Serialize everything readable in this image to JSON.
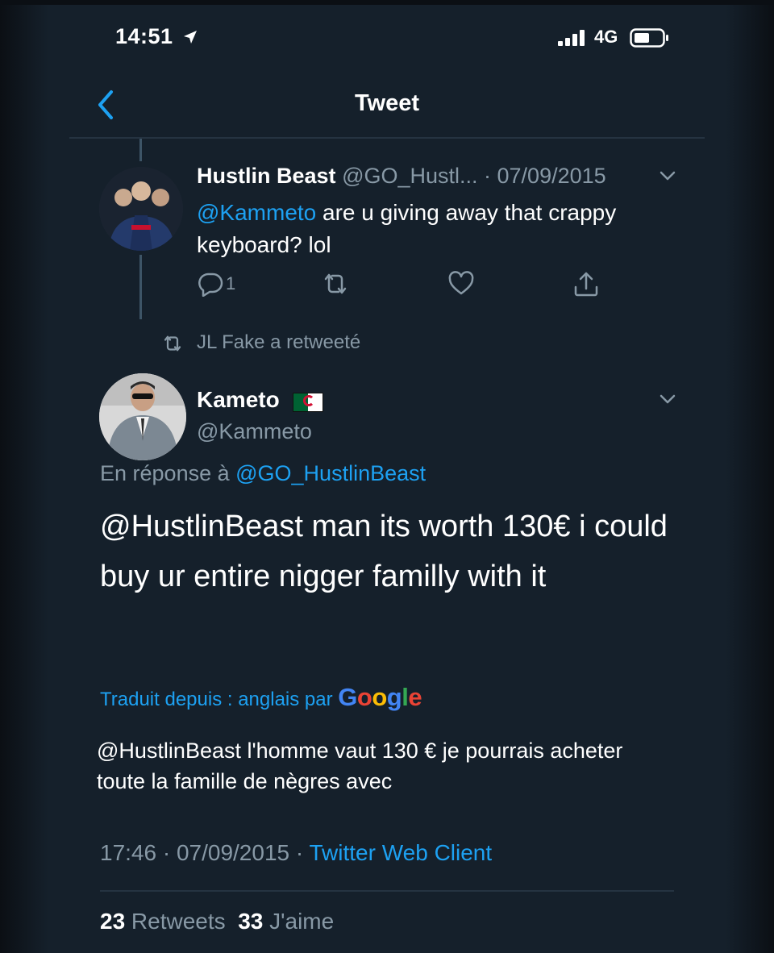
{
  "status_bar": {
    "time": "14:51",
    "network": "4G"
  },
  "nav": {
    "title": "Tweet"
  },
  "parent_tweet": {
    "name": "Hustlin Beast",
    "handle": "@GO_Hustl...",
    "separator": " · ",
    "date": "07/09/2015",
    "mention": "@Kammeto",
    "text": " are u giving away that crappy keyboard? lol",
    "reply_count": "1"
  },
  "retweet_note": "JL Fake a retweeté",
  "main_tweet": {
    "name": "Kameto",
    "handle": "@Kammeto",
    "reply_prefix": "En réponse à ",
    "reply_to": "@GO_HustlinBeast",
    "text": "@HustlinBeast man its worth 130€ i could buy ur entire nigger familly with it",
    "translated_prefix": "Traduit depuis : anglais par ",
    "translation_provider": "Google",
    "translation": "@HustlinBeast l'homme vaut 130 € je pourrais acheter toute la famille de nègres avec",
    "time": "17:46",
    "date_sep": " · 07/09/2015 · ",
    "source": "Twitter Web Client",
    "retweets_count": "23",
    "retweets_label": " Retweets",
    "likes_count": "33",
    "likes_label": " J'aime"
  },
  "colors": {
    "background": "#15202b",
    "accent": "#1da1f2",
    "secondary_text": "#8899a6"
  },
  "icons": [
    "location-arrow-icon",
    "signal-icon",
    "battery-icon",
    "back-chevron-icon",
    "chevron-down-icon",
    "reply-icon",
    "retweet-icon",
    "like-icon",
    "share-icon"
  ]
}
